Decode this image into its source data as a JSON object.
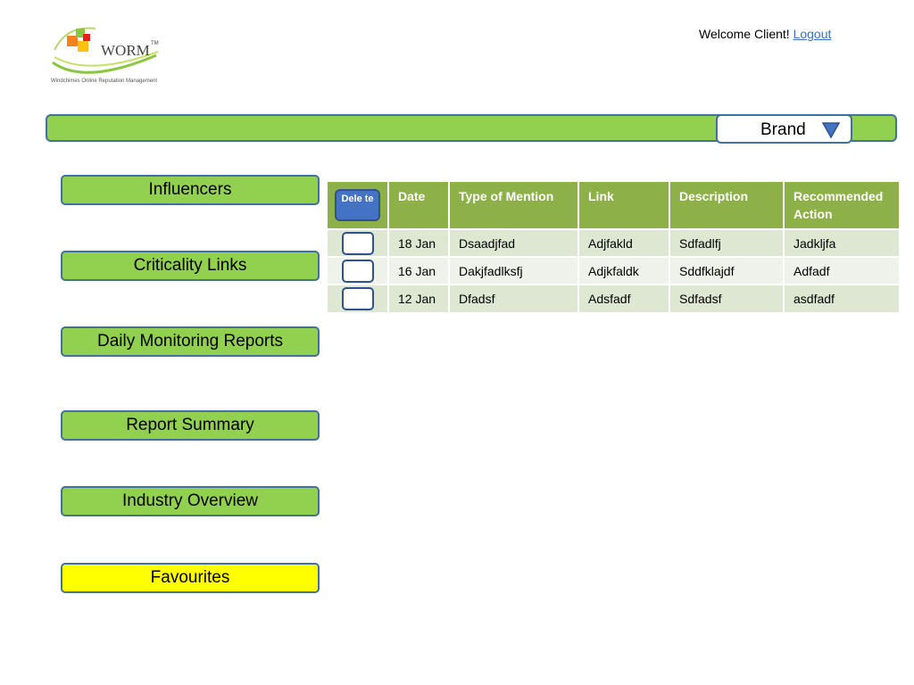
{
  "logo": {
    "brand_text": "WORM",
    "trademark": "TM",
    "tagline": "Windchimes Online Reputation Management",
    "icon": "worm-logo-icon"
  },
  "header": {
    "welcome_text": "Welcome Client! ",
    "logout_label": "Logout"
  },
  "brand_selector": {
    "label": "Brand",
    "icon": "triangle-down-icon"
  },
  "sidebar": {
    "items": [
      {
        "label": "Influencers"
      },
      {
        "label": "Criticality Links"
      },
      {
        "label": "Daily Monitoring Reports"
      },
      {
        "label": "Report Summary"
      },
      {
        "label": "Industry Overview"
      },
      {
        "label": "Favourites"
      }
    ]
  },
  "table": {
    "delete_label": "Dele te",
    "columns": [
      "Date",
      "Type of Mention",
      "Link",
      "Description",
      "Recommended Action"
    ],
    "rows": [
      {
        "date": "18 Jan",
        "type": "Dsaadjfad",
        "link": "Adjfakld",
        "description": "Sdfadlfj",
        "action": "Jadkljfa"
      },
      {
        "date": "16 Jan",
        "type": "Dakjfadlksfj",
        "link": "Adjkfaldk",
        "description": "Sddfklajdf",
        "action": "Adfadf"
      },
      {
        "date": "12 Jan",
        "type": "Dfadsf",
        "link": "Adsfadf",
        "description": "Sdfadsf",
        "action": "asdfadf"
      }
    ]
  },
  "colors": {
    "accent_green": "#92d050",
    "border_blue": "#41719c",
    "header_green": "#8db048",
    "favourite_yellow": "#ffff00"
  }
}
